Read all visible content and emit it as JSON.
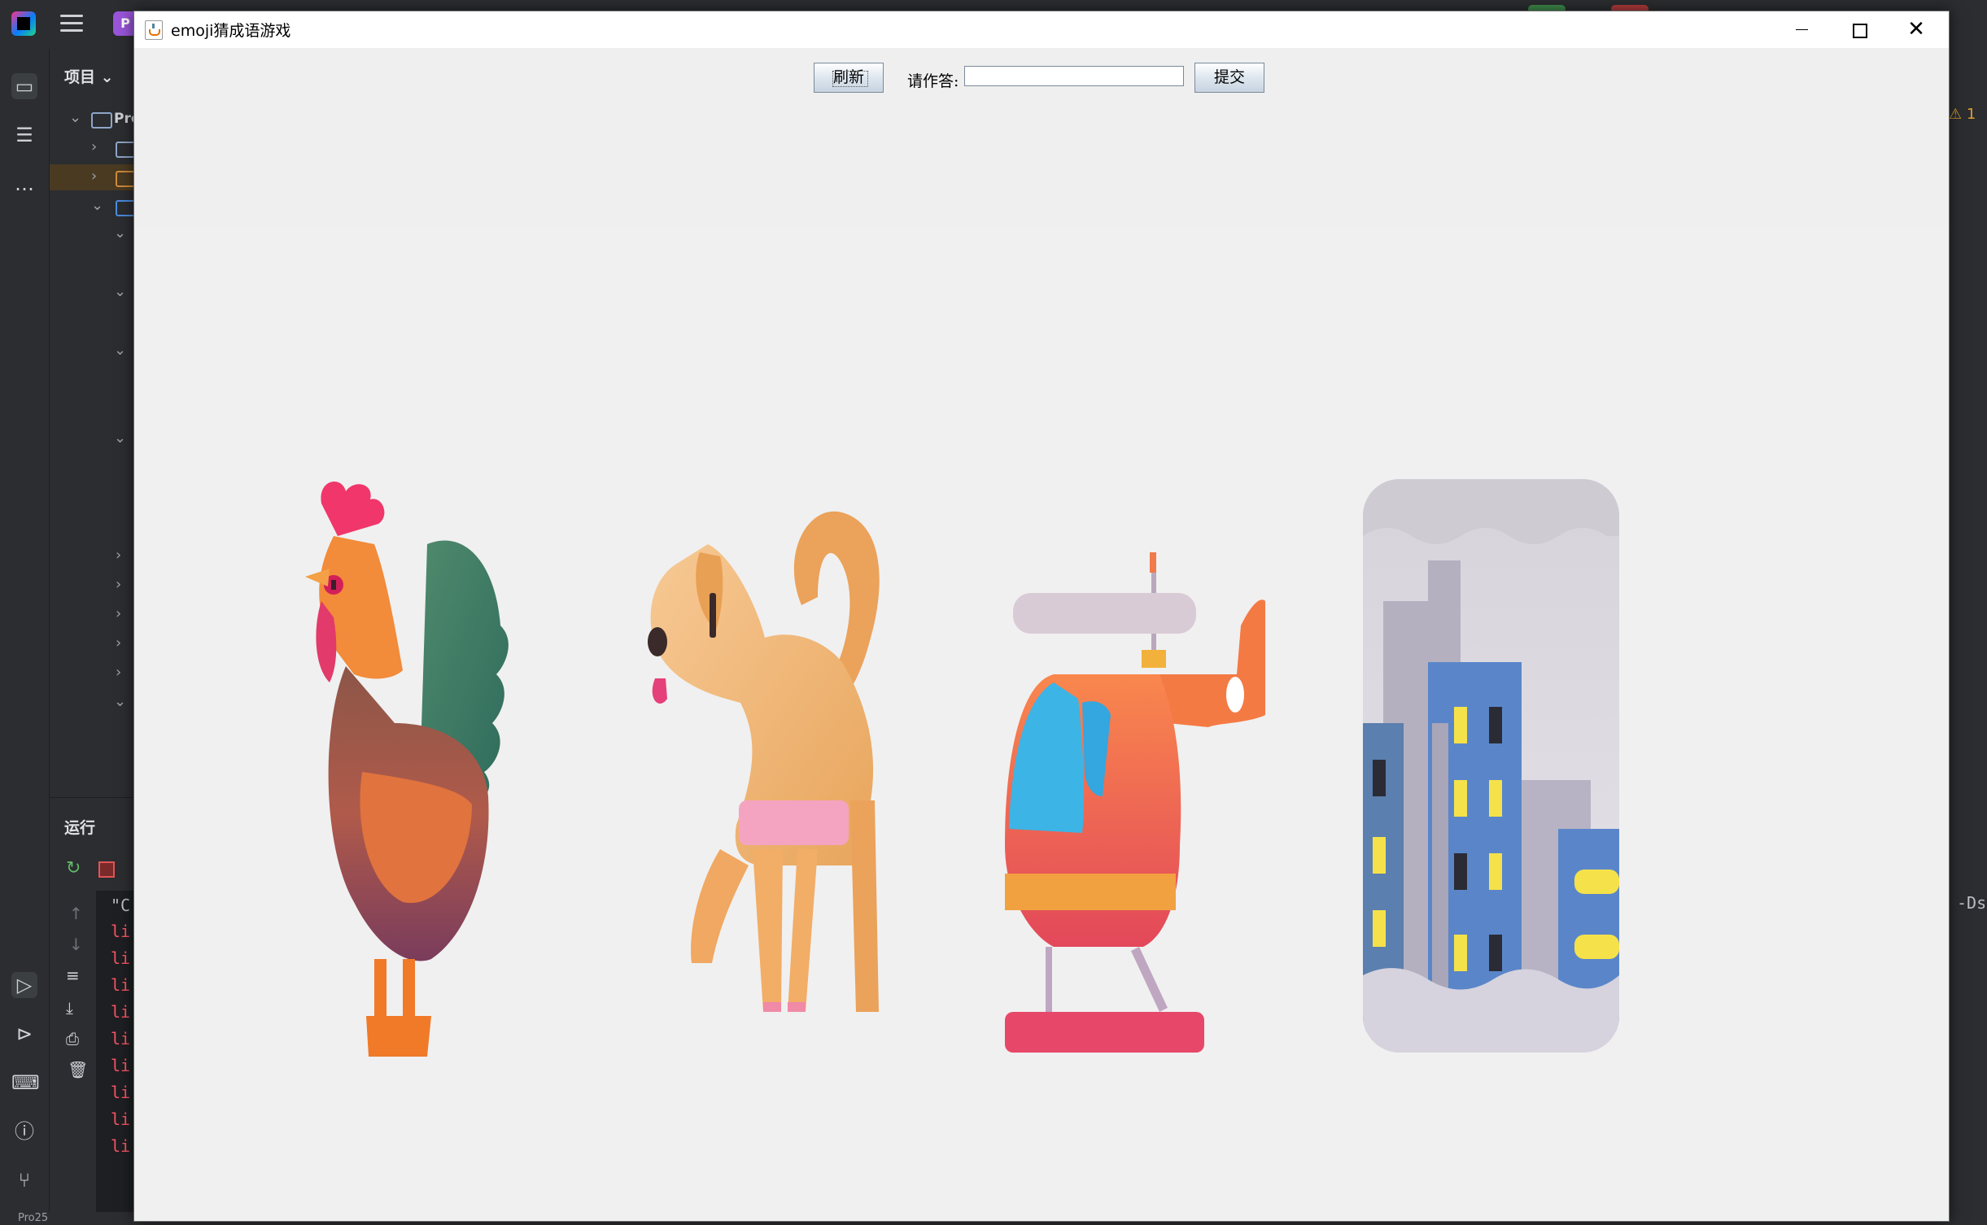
{
  "window": {
    "title": "emoji猜成语游戏",
    "minimize": "–",
    "close": "✕"
  },
  "controls": {
    "refresh_label": "刷新",
    "answer_label": "请作答:",
    "answer_value": "",
    "answer_placeholder": "",
    "submit_label": "提交"
  },
  "emojis": [
    {
      "name": "rooster",
      "description": "rooster emoji"
    },
    {
      "name": "dog",
      "description": "dog emoji"
    },
    {
      "name": "helicopter",
      "description": "helicopter emoji"
    },
    {
      "name": "cityscape",
      "description": "city skyline at dusk emoji"
    }
  ],
  "ide": {
    "project_label": "项目",
    "project_root": "Pro",
    "run_label": "运行",
    "console_first": "\"C",
    "console_line": "li",
    "console_line_count": 9,
    "warning_count": "1",
    "right_console": "-Ds",
    "status_path": "Pro25"
  },
  "colors": {
    "ide_bg": "#2b2d30",
    "window_bg": "#f0f0f0",
    "button_gradient_top": "#ffffff",
    "button_gradient_bottom": "#c7d4e0"
  }
}
